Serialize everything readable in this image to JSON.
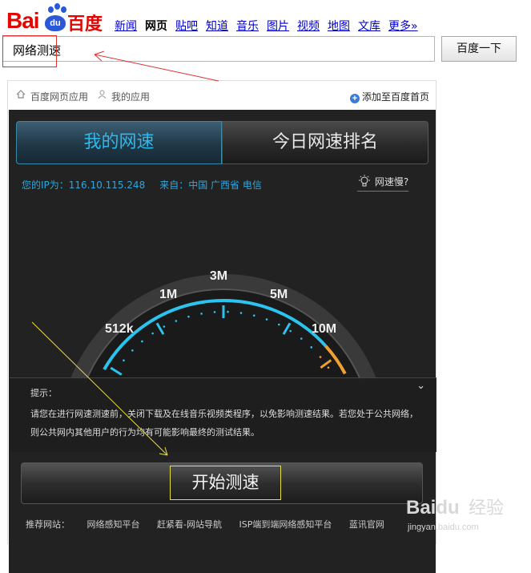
{
  "logo": {
    "bai": "Bai",
    "du": "du",
    "cn": "百度"
  },
  "nav": {
    "items": [
      "新闻",
      "网页",
      "贴吧",
      "知道",
      "音乐",
      "图片",
      "视频",
      "地图",
      "文库",
      "更多»"
    ],
    "current": "网页"
  },
  "search": {
    "value": "网络测速",
    "button": "百度一下"
  },
  "app_bar": {
    "web_apps": "百度网页应用",
    "my_apps": "我的应用",
    "add_home": "添加至百度首页"
  },
  "tabs": {
    "my_speed": "我的网速",
    "today_rank": "今日网速排名"
  },
  "ip_info": {
    "ip": "您的IP为：116.10.115.248",
    "from": "来自：中国  广西省 电信"
  },
  "slow_link": "网速慢?",
  "gauge": {
    "labels": [
      "512k",
      "1M",
      "3M",
      "5M",
      "10M"
    ]
  },
  "notice": {
    "title": "提示：",
    "body": "请您在进行网速测速前，关闭下载及在线音乐视频类程序，以免影响测速结果。若您处于公共网络，则公共网内其他用户的行为均有可能影响最终的测试结果。"
  },
  "start_button": "开始测速",
  "recommend": {
    "label": "推荐网站：",
    "sites": [
      "网络感知平台",
      "赶紧看-网站导航",
      "ISP端到端网络感知平台",
      "蓝讯官网"
    ]
  },
  "watermark": {
    "brand": "Baidu",
    "cn": "经验",
    "url": "jingyan.baidu.com"
  },
  "colors": {
    "brand_red": "#e10601",
    "brand_blue": "#2b58d8",
    "gauge_cyan": "#2bc4ee",
    "gauge_orange": "#f0a030",
    "annot_red": "#e03030",
    "annot_yellow": "#e9de3b"
  }
}
